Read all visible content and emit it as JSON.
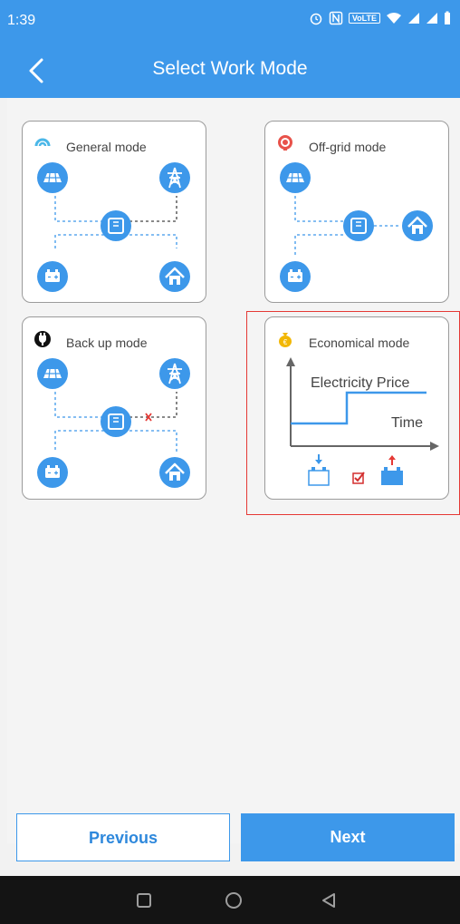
{
  "status": {
    "time": "1:39",
    "volte": "VoLTE"
  },
  "header": {
    "title": "Select Work Mode"
  },
  "modes": [
    {
      "label": "General mode"
    },
    {
      "label": "Off-grid mode"
    },
    {
      "label": "Back up mode"
    },
    {
      "label": "Economical mode",
      "selected": true,
      "chart": {
        "price_label": "Electricity Price",
        "time_label": "Time"
      }
    }
  ],
  "buttons": {
    "previous": "Previous",
    "next": "Next"
  },
  "colors": {
    "primary": "#3d98ea",
    "selection": "#e53935"
  },
  "icons": [
    "back-arrow-icon",
    "solar-panel-icon",
    "power-tower-icon",
    "inverter-icon",
    "battery-icon",
    "home-icon",
    "square-nav-icon",
    "circle-nav-icon",
    "triangle-back-icon"
  ]
}
